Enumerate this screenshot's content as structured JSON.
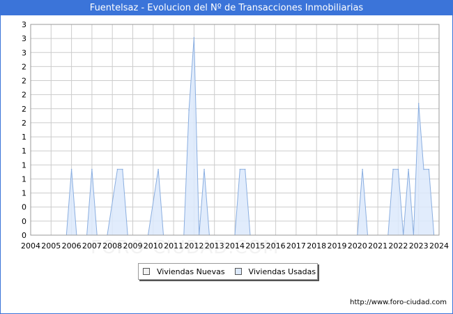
{
  "title": "Fuentelsaz - Evolucion del Nº de Transacciones Inmobiliarias",
  "source": "http://www.foro-ciudad.com",
  "watermark": "FORO-CIUDAD.COM",
  "colors": {
    "titlebar": "#3b74d9",
    "nuevas_fill": "#f2f2f2",
    "usadas_fill": "#dce9fb",
    "usadas_stroke": "#8aaee0",
    "grid": "#cccccc"
  },
  "chart_data": {
    "type": "area",
    "title": "Fuentelsaz - Evolucion del Nº de Transacciones Inmobiliarias",
    "xlabel": "",
    "ylabel": "",
    "x_ticks": [
      "2004",
      "2005",
      "2006",
      "2007",
      "2008",
      "2009",
      "2010",
      "2011",
      "2012",
      "2013",
      "2014",
      "2015",
      "2016",
      "2017",
      "2018",
      "2019",
      "2020",
      "2021",
      "2022",
      "2023",
      "2024"
    ],
    "xlim": [
      2004,
      2024
    ],
    "y_tick_labels": [
      "0",
      "0",
      "0",
      "1",
      "1",
      "1",
      "1",
      "1",
      "2",
      "2",
      "2",
      "2",
      "2",
      "3",
      "3",
      "3"
    ],
    "ylim": [
      0,
      3.2
    ],
    "grid": true,
    "legend_position": "bottom-center",
    "series": [
      {
        "name": "Viviendas Nuevas",
        "x": [
          2004,
          2024
        ],
        "values": [
          0,
          0
        ]
      },
      {
        "name": "Viviendas Usadas",
        "x": [
          2005.75,
          2006,
          2006.25,
          2006.75,
          2007,
          2007.25,
          2007.75,
          2008.25,
          2008.5,
          2008.75,
          2009.75,
          2010.25,
          2010.5,
          2010.75,
          2011.5,
          2011.75,
          2012,
          2012.25,
          2012.5,
          2012.75,
          2013,
          2013.25,
          2014,
          2014.25,
          2014.5,
          2014.75,
          2020,
          2020.25,
          2020.5,
          2021.5,
          2021.75,
          2022,
          2022.25,
          2022.5,
          2022.75,
          2023,
          2023.25,
          2023.5,
          2023.75,
          2024
        ],
        "values": [
          0,
          1,
          0,
          0,
          1,
          0,
          0,
          1,
          1,
          0,
          0,
          1,
          0,
          0,
          0,
          1.9,
          3,
          0,
          1,
          0,
          0,
          0,
          0,
          1,
          1,
          0,
          0,
          1,
          0,
          0,
          1,
          1,
          0,
          1,
          0,
          2,
          1,
          1,
          0,
          0
        ]
      }
    ]
  },
  "legend": {
    "items": [
      {
        "label": "Viviendas Nuevas"
      },
      {
        "label": "Viviendas Usadas"
      }
    ]
  }
}
